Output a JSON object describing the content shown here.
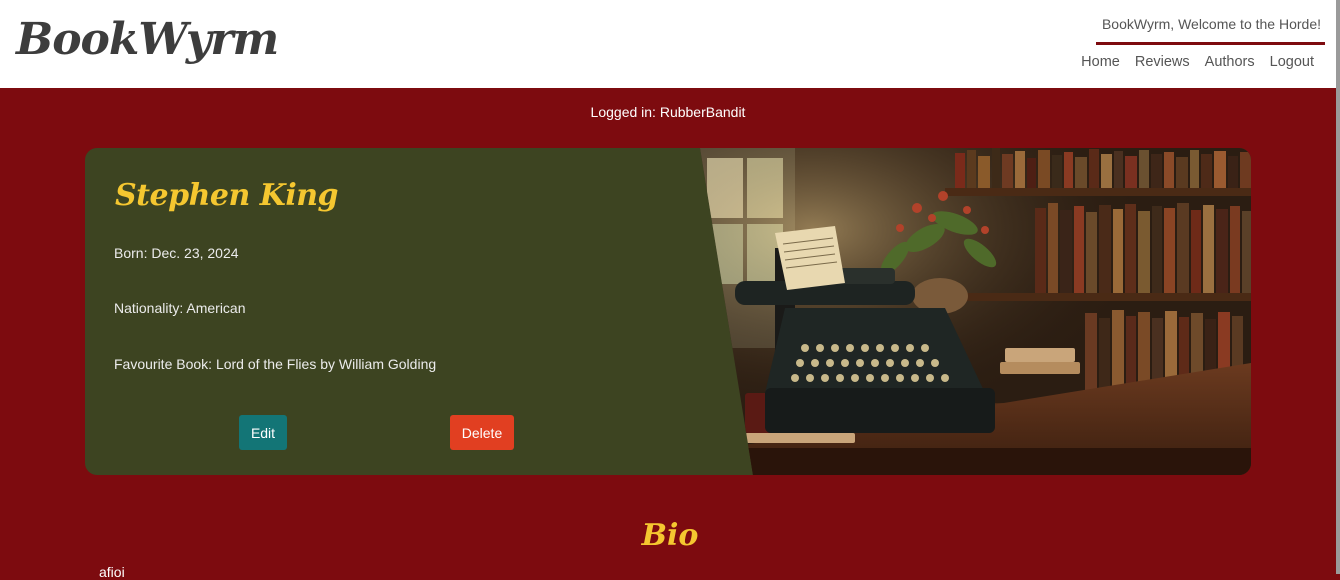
{
  "header": {
    "brand": "BookWyrm",
    "welcome": "BookWyrm, Welcome to the Horde!",
    "nav": [
      "Home",
      "Reviews",
      "Authors",
      "Logout"
    ]
  },
  "session": {
    "logged_in": "Logged in: RubberBandit"
  },
  "author": {
    "name": "Stephen King",
    "born": "Born: Dec. 23, 2024",
    "nationality": "Nationality: American",
    "favourite_book": "Favourite Book: Lord of the Flies by William Golding",
    "edit_label": "Edit",
    "delete_label": "Delete"
  },
  "bio": {
    "title": "Bio",
    "text": "afioi"
  },
  "colors": {
    "background": "#7d0b0f",
    "card": "#3d4421",
    "accent_text": "#f5c730",
    "edit_button": "#137576",
    "delete_button": "#e13f21"
  },
  "icons": {
    "card_image": "vintage-typewriter-library-image"
  }
}
